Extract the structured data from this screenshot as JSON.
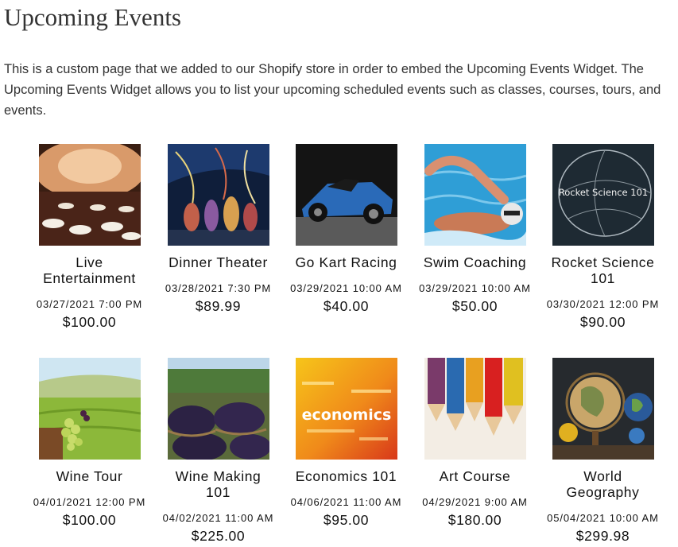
{
  "page": {
    "title": "Upcoming Events",
    "intro": "This is a custom page that we added to our Shopify store in order to embed the Upcoming Events Widget. The Upcoming Events Widget allows you to list your upcoming scheduled events such as classes, courses, tours, and events."
  },
  "events": [
    {
      "title": "Live Entertainment",
      "date": "03/27/2021 7:00 PM",
      "price": "$100.00",
      "image": "banquet-hall-image"
    },
    {
      "title": "Dinner Theater",
      "date": "03/28/2021 7:30 PM",
      "price": "$89.99",
      "image": "stage-performers-image"
    },
    {
      "title": "Go Kart Racing",
      "date": "03/29/2021 10:00 AM",
      "price": "$40.00",
      "image": "kart-car-image"
    },
    {
      "title": "Swim Coaching",
      "date": "03/29/2021 10:00 AM",
      "price": "$50.00",
      "image": "swimmer-image"
    },
    {
      "title": "Rocket Science 101",
      "date": "03/30/2021 12:00 PM",
      "price": "$90.00",
      "image": "chalkboard-globe-image",
      "image_text": "Rocket Science 101"
    },
    {
      "title": "Wine Tour",
      "date": "04/01/2021 12:00 PM",
      "price": "$100.00",
      "image": "vineyard-grapes-image"
    },
    {
      "title": "Wine Making 101",
      "date": "04/02/2021 11:00 AM",
      "price": "$225.00",
      "image": "grape-baskets-image"
    },
    {
      "title": "Economics 101",
      "date": "04/06/2021 11:00 AM",
      "price": "$95.00",
      "image": "economics-word-cloud-image",
      "image_text": "economics"
    },
    {
      "title": "Art Course",
      "date": "04/29/2021 9:00 AM",
      "price": "$180.00",
      "image": "colored-pencils-image"
    },
    {
      "title": "World Geography",
      "date": "05/04/2021 10:00 AM",
      "price": "$299.98",
      "image": "globes-image"
    }
  ]
}
